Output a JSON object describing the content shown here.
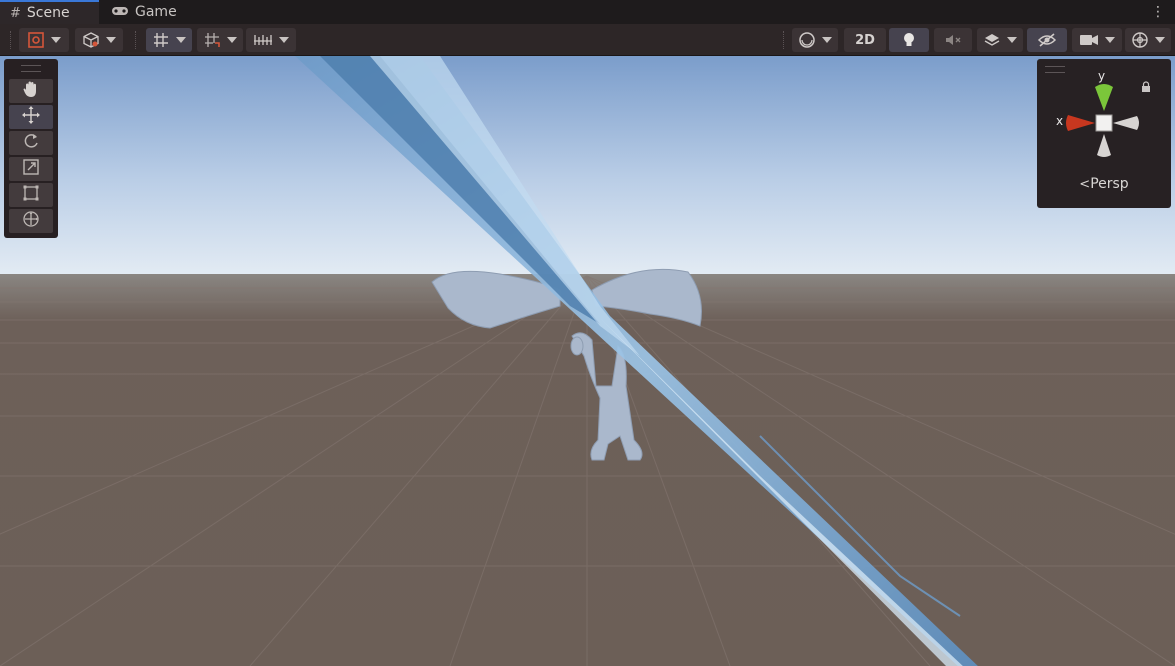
{
  "tabs": [
    {
      "label": "Scene",
      "icon": "grid-icon",
      "active": true
    },
    {
      "label": "Game",
      "icon": "gamepad-icon",
      "active": false
    }
  ],
  "toolbar": {
    "toggle_2d_label": "2D"
  },
  "tools": [
    "hand",
    "move",
    "rotate",
    "scale",
    "rect",
    "transform"
  ],
  "active_tool": "move",
  "gizmo": {
    "y_label": "y",
    "x_label": "x",
    "projection_label": "Persp"
  },
  "colors": {
    "accent": "#3a78d8",
    "toolbar_bg": "#2d2627",
    "sky_top": "#7d9fcc",
    "ground": "#6b5e56",
    "x_axis": "#c8371f",
    "y_axis": "#7bc63a"
  }
}
